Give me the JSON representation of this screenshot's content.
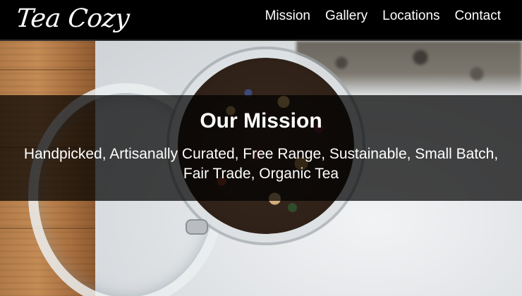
{
  "header": {
    "logo": "Tea Cozy",
    "nav": [
      "Mission",
      "Gallery",
      "Locations",
      "Contact"
    ]
  },
  "hero": {
    "title": "Our Mission",
    "tagline": "Handpicked, Artisanally Curated, Free Range, Sustainable, Small Batch, Fair Trade, Organic Tea"
  },
  "colors": {
    "header_bg": "#000000",
    "banner_overlay": "rgba(0,0,0,0.72)",
    "text": "#ffffff"
  }
}
